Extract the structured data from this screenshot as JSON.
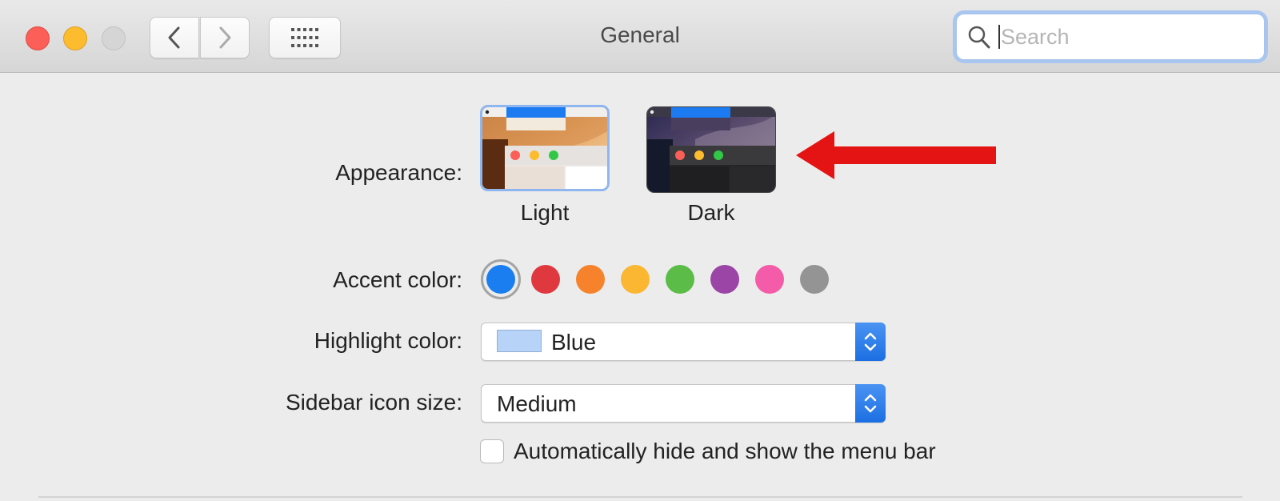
{
  "window": {
    "title": "General"
  },
  "toolbar": {
    "back_icon": "chevron-left-icon",
    "forward_icon": "chevron-right-icon",
    "grid_icon": "grid-icon"
  },
  "search": {
    "placeholder": "Search",
    "value": ""
  },
  "appearance": {
    "label": "Appearance:",
    "options": [
      {
        "label": "Light",
        "selected": true
      },
      {
        "label": "Dark",
        "selected": false
      }
    ]
  },
  "accent": {
    "label": "Accent color:",
    "colors": [
      "#1a7ef0",
      "#e0383f",
      "#f6822b",
      "#fbb731",
      "#5bbd47",
      "#9b45a7",
      "#f45ba8",
      "#949494"
    ],
    "selected_index": 0
  },
  "highlight": {
    "label": "Highlight color:",
    "value": "Blue",
    "chip_color": "#b7d3f7"
  },
  "sidebar_icon_size": {
    "label": "Sidebar icon size:",
    "value": "Medium"
  },
  "menu_bar": {
    "label": "Automatically hide and show the menu bar",
    "checked": false
  },
  "annotation": {
    "arrow_color": "#e51414"
  }
}
